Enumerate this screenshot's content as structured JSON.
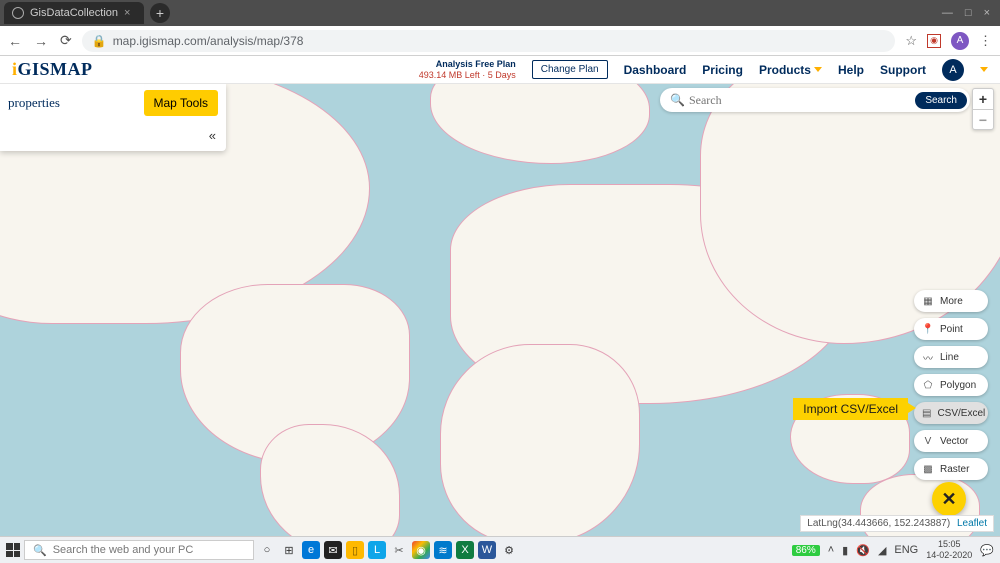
{
  "browser": {
    "tab_title": "GisDataCollection",
    "url": "map.igismap.com/analysis/map/378",
    "user_initial": "A"
  },
  "header": {
    "logo": "iGISMAP",
    "plan_title": "Analysis Free Plan",
    "plan_sub": "493.14 MB Left · 5 Days",
    "change_plan": "Change Plan",
    "nav": {
      "dashboard": "Dashboard",
      "pricing": "Pricing",
      "products": "Products",
      "help": "Help",
      "support": "Support"
    },
    "user_initial": "A"
  },
  "sidebar": {
    "title": "properties",
    "map_tools": "Map Tools"
  },
  "search": {
    "placeholder": "Search",
    "button": "Search"
  },
  "tools": {
    "more": "More",
    "point": "Point",
    "line": "Line",
    "polygon": "Polygon",
    "csv": "CSV/Excel",
    "vector": "Vector",
    "raster": "Raster",
    "tooltip": "Import CSV/Excel"
  },
  "status": {
    "latlng": "LatLng(34.443666, 152.243887)",
    "leaflet": "Leaflet"
  },
  "taskbar": {
    "search_placeholder": "Search the web and your PC",
    "battery": "86%",
    "lang": "ENG",
    "time": "15:05",
    "date": "14-02-2020"
  }
}
